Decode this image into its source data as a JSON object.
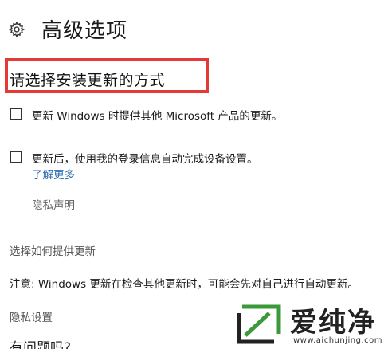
{
  "header": {
    "title": "高级选项",
    "icon": "gear-icon"
  },
  "section": {
    "heading": "请选择安装更新的方式"
  },
  "options": [
    {
      "label": "更新 Windows 时提供其他 Microsoft 产品的更新。",
      "checked": false
    },
    {
      "label": "更新后，使用我的登录信息自动完成设备设置。",
      "checked": false
    }
  ],
  "links": {
    "learn_more": "了解更多",
    "privacy_statement": "隐私声明"
  },
  "delivery": {
    "heading": "选择如何提供更新"
  },
  "note": "注意: Windows 更新在检查其他更新时，可能会先对自己进行自动更新。",
  "privacy": {
    "heading": "隐私设置"
  },
  "question": "有问题吗?",
  "watermark": {
    "brand": "爱纯净",
    "url": "www.aichunjing.com"
  },
  "colors": {
    "highlight_border": "#e53935",
    "link": "#2b6cb0",
    "watermark_green": "#3a9a3a"
  }
}
